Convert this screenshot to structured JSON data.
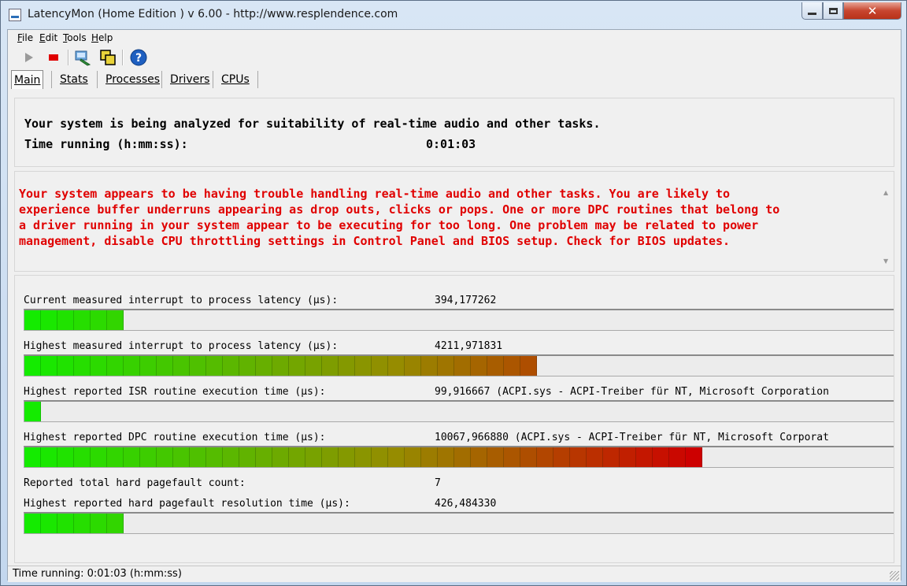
{
  "window": {
    "title": "LatencyMon  (Home Edition )  v 6.00 - http://www.resplendence.com"
  },
  "menu": [
    "File",
    "Edit",
    "Tools",
    "Help"
  ],
  "toolbar": {
    "buttons": [
      "play-icon",
      "stop-icon",
      "driver-icon",
      "cpus-icon",
      "help-icon"
    ],
    "stop_color": "#e00000",
    "help_color": "#1e5fc0"
  },
  "tabs": [
    "Main",
    "Stats",
    "Processes",
    "Drivers",
    "CPUs"
  ],
  "analysis": {
    "headline": "Your system is being analyzed for suitability of real-time audio and other tasks.",
    "time_label": "Time running (h:mm:ss):",
    "time_value": "0:01:03"
  },
  "warning": {
    "color": "#e00000",
    "lines": [
      "Your system appears to be having trouble handling real-time audio and other tasks. You are likely to",
      "experience buffer underruns appearing as drop outs, clicks or pops. One or more DPC routines that belong to",
      "a driver running in your system appear to be executing for too long. One problem may be related to power",
      "management, disable CPU throttling settings in Control Panel and BIOS setup. Check for BIOS updates."
    ]
  },
  "metrics": [
    {
      "label": "Current measured interrupt to process latency (µs):",
      "value": "394,177262",
      "detail": "",
      "bar_segments": 6
    },
    {
      "label": "Highest measured interrupt to process latency (µs):",
      "value": "4211,971831",
      "detail": "",
      "bar_segments": 31
    },
    {
      "label": "Highest reported ISR routine execution time (µs):",
      "value": "99,916667",
      "detail": "(ACPI.sys - ACPI-Treiber für NT, Microsoft Corporation",
      "bar_segments": 1
    },
    {
      "label": "Highest reported DPC routine execution time (µs):",
      "value": "10067,966880",
      "detail": "(ACPI.sys - ACPI-Treiber für NT, Microsoft Corporat",
      "bar_segments": 41
    },
    {
      "label": "Reported total hard pagefault count:",
      "value": "7",
      "detail": "",
      "bar_segments": null
    },
    {
      "label": "Highest reported hard pagefault resolution time (µs):",
      "value": "426,484330",
      "detail": "",
      "bar_segments": 6
    }
  ],
  "status": {
    "text": "Time running: 0:01:03  (h:mm:ss)"
  }
}
